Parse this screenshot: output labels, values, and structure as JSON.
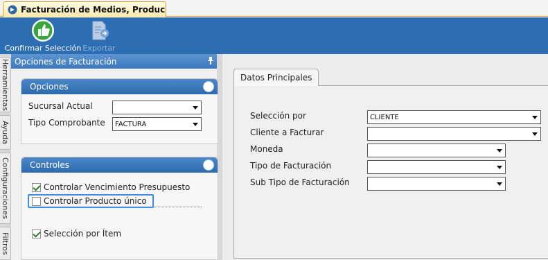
{
  "document_tab": {
    "title": "Facturación de Medios, Producci..."
  },
  "ribbon": {
    "confirm_label": "Confirmar Selección",
    "export_label": "Exportar"
  },
  "side_tabs": [
    "Herramientas",
    "Ayuda",
    "Configuraciones",
    "Filtros"
  ],
  "left_panel": {
    "title": "Opciones de Facturación",
    "opciones": {
      "title": "Opciones",
      "sucursal_label": "Sucursal Actual",
      "sucursal_value": "",
      "tipo_label": "Tipo Comprobante",
      "tipo_value": "FACTURA"
    },
    "controles": {
      "title": "Controles",
      "items": [
        {
          "label": "Controlar Vencimiento Presupuesto",
          "checked": true
        },
        {
          "label": "Controlar Producto único",
          "checked": false
        },
        {
          "label": "Selección por Ítem",
          "checked": true
        }
      ]
    }
  },
  "main": {
    "tab_label": "Datos Principales",
    "fields": [
      {
        "label": "Selección por",
        "value": "CLIENTE"
      },
      {
        "label": "Cliente a Facturar",
        "value": ""
      },
      {
        "label": "Moneda",
        "value": ""
      },
      {
        "label": "Tipo de Facturación",
        "value": ""
      },
      {
        "label": "Sub Tipo de Facturación",
        "value": ""
      }
    ]
  },
  "colors": {
    "ribbon": "#2d6eb3",
    "header_blue": "#3b78bd",
    "focus": "#3d8ce8",
    "tab_orange": "#d59b2c"
  }
}
